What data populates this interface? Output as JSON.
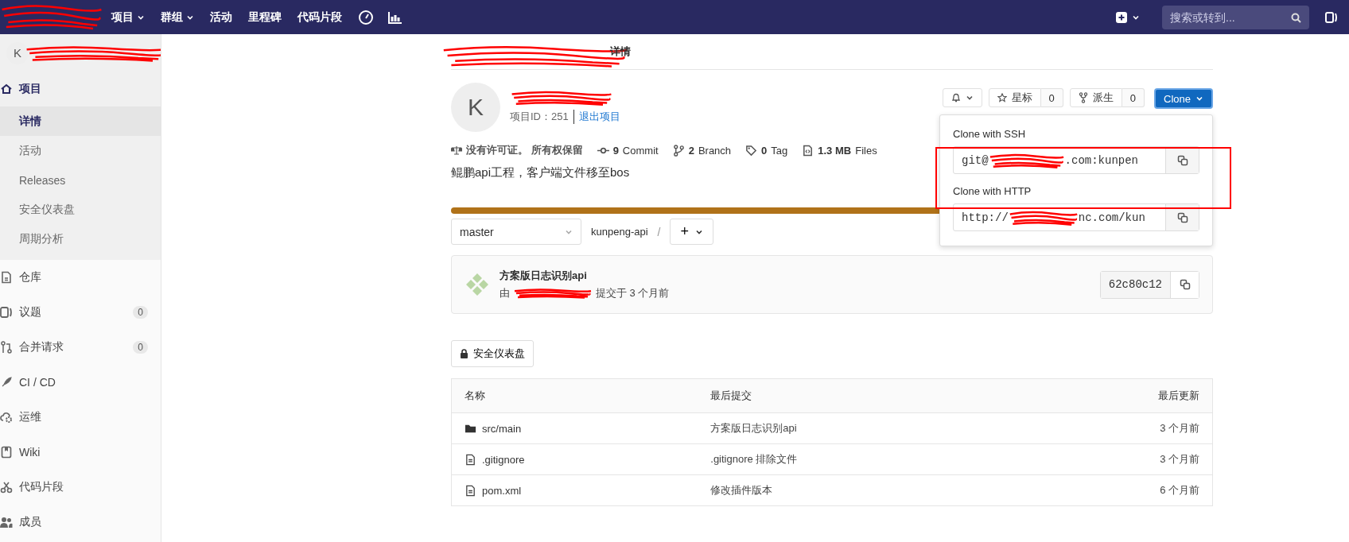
{
  "navbar": {
    "menus": [
      {
        "label": "项目",
        "dropdown": true
      },
      {
        "label": "群组",
        "dropdown": true
      },
      {
        "label": "活动",
        "dropdown": false
      },
      {
        "label": "里程碑",
        "dropdown": false
      },
      {
        "label": "代码片段",
        "dropdown": false
      }
    ],
    "search": {
      "placeholder": "搜索或转到..."
    }
  },
  "sidebar": {
    "project_avatar": "K",
    "items": [
      {
        "label": "项目",
        "selected": true,
        "expanded": true,
        "children": [
          {
            "label": "详情",
            "selected": true
          },
          {
            "label": "活动",
            "selected": false
          },
          {
            "label": "Releases",
            "selected": false
          },
          {
            "label": "安全仪表盘",
            "selected": false
          },
          {
            "label": "周期分析",
            "selected": false
          }
        ]
      },
      {
        "label": "仓库",
        "selected": false
      },
      {
        "label": "议题",
        "selected": false,
        "count": "0"
      },
      {
        "label": "合并请求",
        "selected": false,
        "count": "0"
      },
      {
        "label": "CI / CD",
        "selected": false
      },
      {
        "label": "运维",
        "selected": false
      },
      {
        "label": "Wiki",
        "selected": false
      },
      {
        "label": "代码片段",
        "selected": false
      },
      {
        "label": "成员",
        "selected": false
      }
    ]
  },
  "breadcrumb": {
    "current": "详情"
  },
  "project": {
    "avatar": "K",
    "id_text": "项目ID：251",
    "leave_link": "退出项目",
    "star": {
      "label": "星标",
      "count": "0"
    },
    "fork": {
      "label": "派生",
      "count": "0"
    },
    "clone_button": "Clone",
    "clone_menu": {
      "open": true,
      "ssh_label": "Clone with SSH",
      "ssh_start": "git@",
      "ssh_end": ".com:kunpen",
      "http_label": "Clone with HTTP",
      "http_start": "http://",
      "http_end": "nc.com/kun"
    },
    "license": "没有许可证。 所有权保留",
    "stats": [
      {
        "kind": "commit",
        "count": "9",
        "label": "Commit"
      },
      {
        "kind": "branch",
        "count": "2",
        "label": "Branch"
      },
      {
        "kind": "tag",
        "count": "0",
        "label": "Tag"
      },
      {
        "kind": "files",
        "count": "1.3 MB",
        "label": "Files"
      }
    ],
    "description": "鲲鹏api工程，客户端文件移至bos",
    "languages": [
      {
        "color": "#b07219"
      }
    ]
  },
  "tree": {
    "ref": "master",
    "path": "kunpeng-api",
    "separator": "/",
    "add": "+"
  },
  "last_commit": {
    "title": "方案版日志识别api",
    "by": "由",
    "when": "提交于 3 个月前",
    "sha": "62c80c12"
  },
  "security_button": "安全仪表盘",
  "table": {
    "columns": [
      "名称",
      "最后提交",
      "最后更新"
    ],
    "rows": [
      {
        "kind": "folder",
        "name": "src/main",
        "commit": "方案版日志识别api",
        "updated": "3 个月前"
      },
      {
        "kind": "file",
        "name": ".gitignore",
        "commit": ".gitignore 排除文件",
        "updated": "3 个月前"
      },
      {
        "kind": "file",
        "name": "pom.xml",
        "commit": "修改插件版本",
        "updated": "6 个月前"
      }
    ]
  }
}
